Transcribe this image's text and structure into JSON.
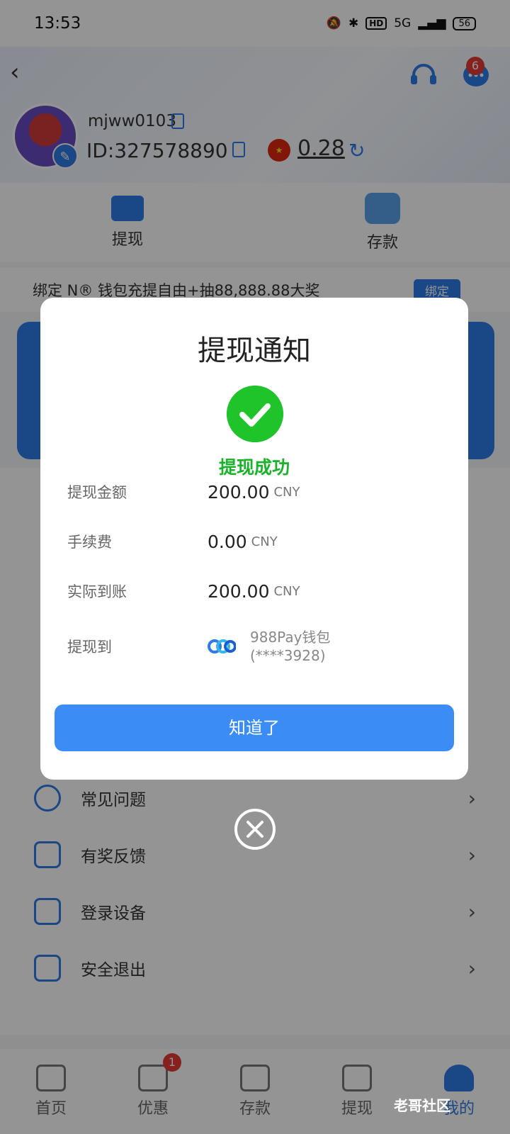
{
  "status_bar": {
    "time": "13:53",
    "hd": "HD",
    "network": "5G",
    "battery": "56"
  },
  "header": {
    "support_badge": "",
    "message_badge": "6"
  },
  "user": {
    "username": "mjww0103",
    "id_label": "ID:",
    "id_value": "327578890",
    "balance": "0.28",
    "currency_flag": "CN"
  },
  "quick_actions": [
    {
      "label": "提现",
      "icon": "withdraw-icon"
    },
    {
      "label": "存款",
      "icon": "wallet-icon"
    }
  ],
  "banner": {
    "text": "绑定 N® 钱包充提自由+抽88,888.88大奖",
    "bind_label": "绑定"
  },
  "menu": [
    {
      "label": "常见问题",
      "icon": "question-icon"
    },
    {
      "label": "有奖反馈",
      "icon": "edit-icon"
    },
    {
      "label": "登录设备",
      "icon": "devices-icon"
    },
    {
      "label": "安全退出",
      "icon": "logout-icon"
    }
  ],
  "tabs": [
    {
      "label": "首页",
      "icon": "home-icon"
    },
    {
      "label": "优惠",
      "icon": "gift-icon",
      "badge": "1"
    },
    {
      "label": "存款",
      "icon": "wallet-icon"
    },
    {
      "label": "提现",
      "icon": "withdraw-icon"
    },
    {
      "label": "我的",
      "icon": "user-icon"
    }
  ],
  "modal": {
    "title": "提现通知",
    "status": "提现成功",
    "rows": [
      {
        "label": "提现金额",
        "value": "200.00",
        "currency": "CNY"
      },
      {
        "label": "手续费",
        "value": "0.00",
        "currency": "CNY"
      },
      {
        "label": "实际到账",
        "value": "200.00",
        "currency": "CNY"
      }
    ],
    "dest_label": "提现到",
    "dest_wallet": "988Pay钱包",
    "dest_account": "(****3928)",
    "ok_label": "知道了"
  },
  "watermark": "老哥社区",
  "colors": {
    "primary": "#2e7be6",
    "success": "#1fc32a",
    "badge": "#e53935"
  }
}
